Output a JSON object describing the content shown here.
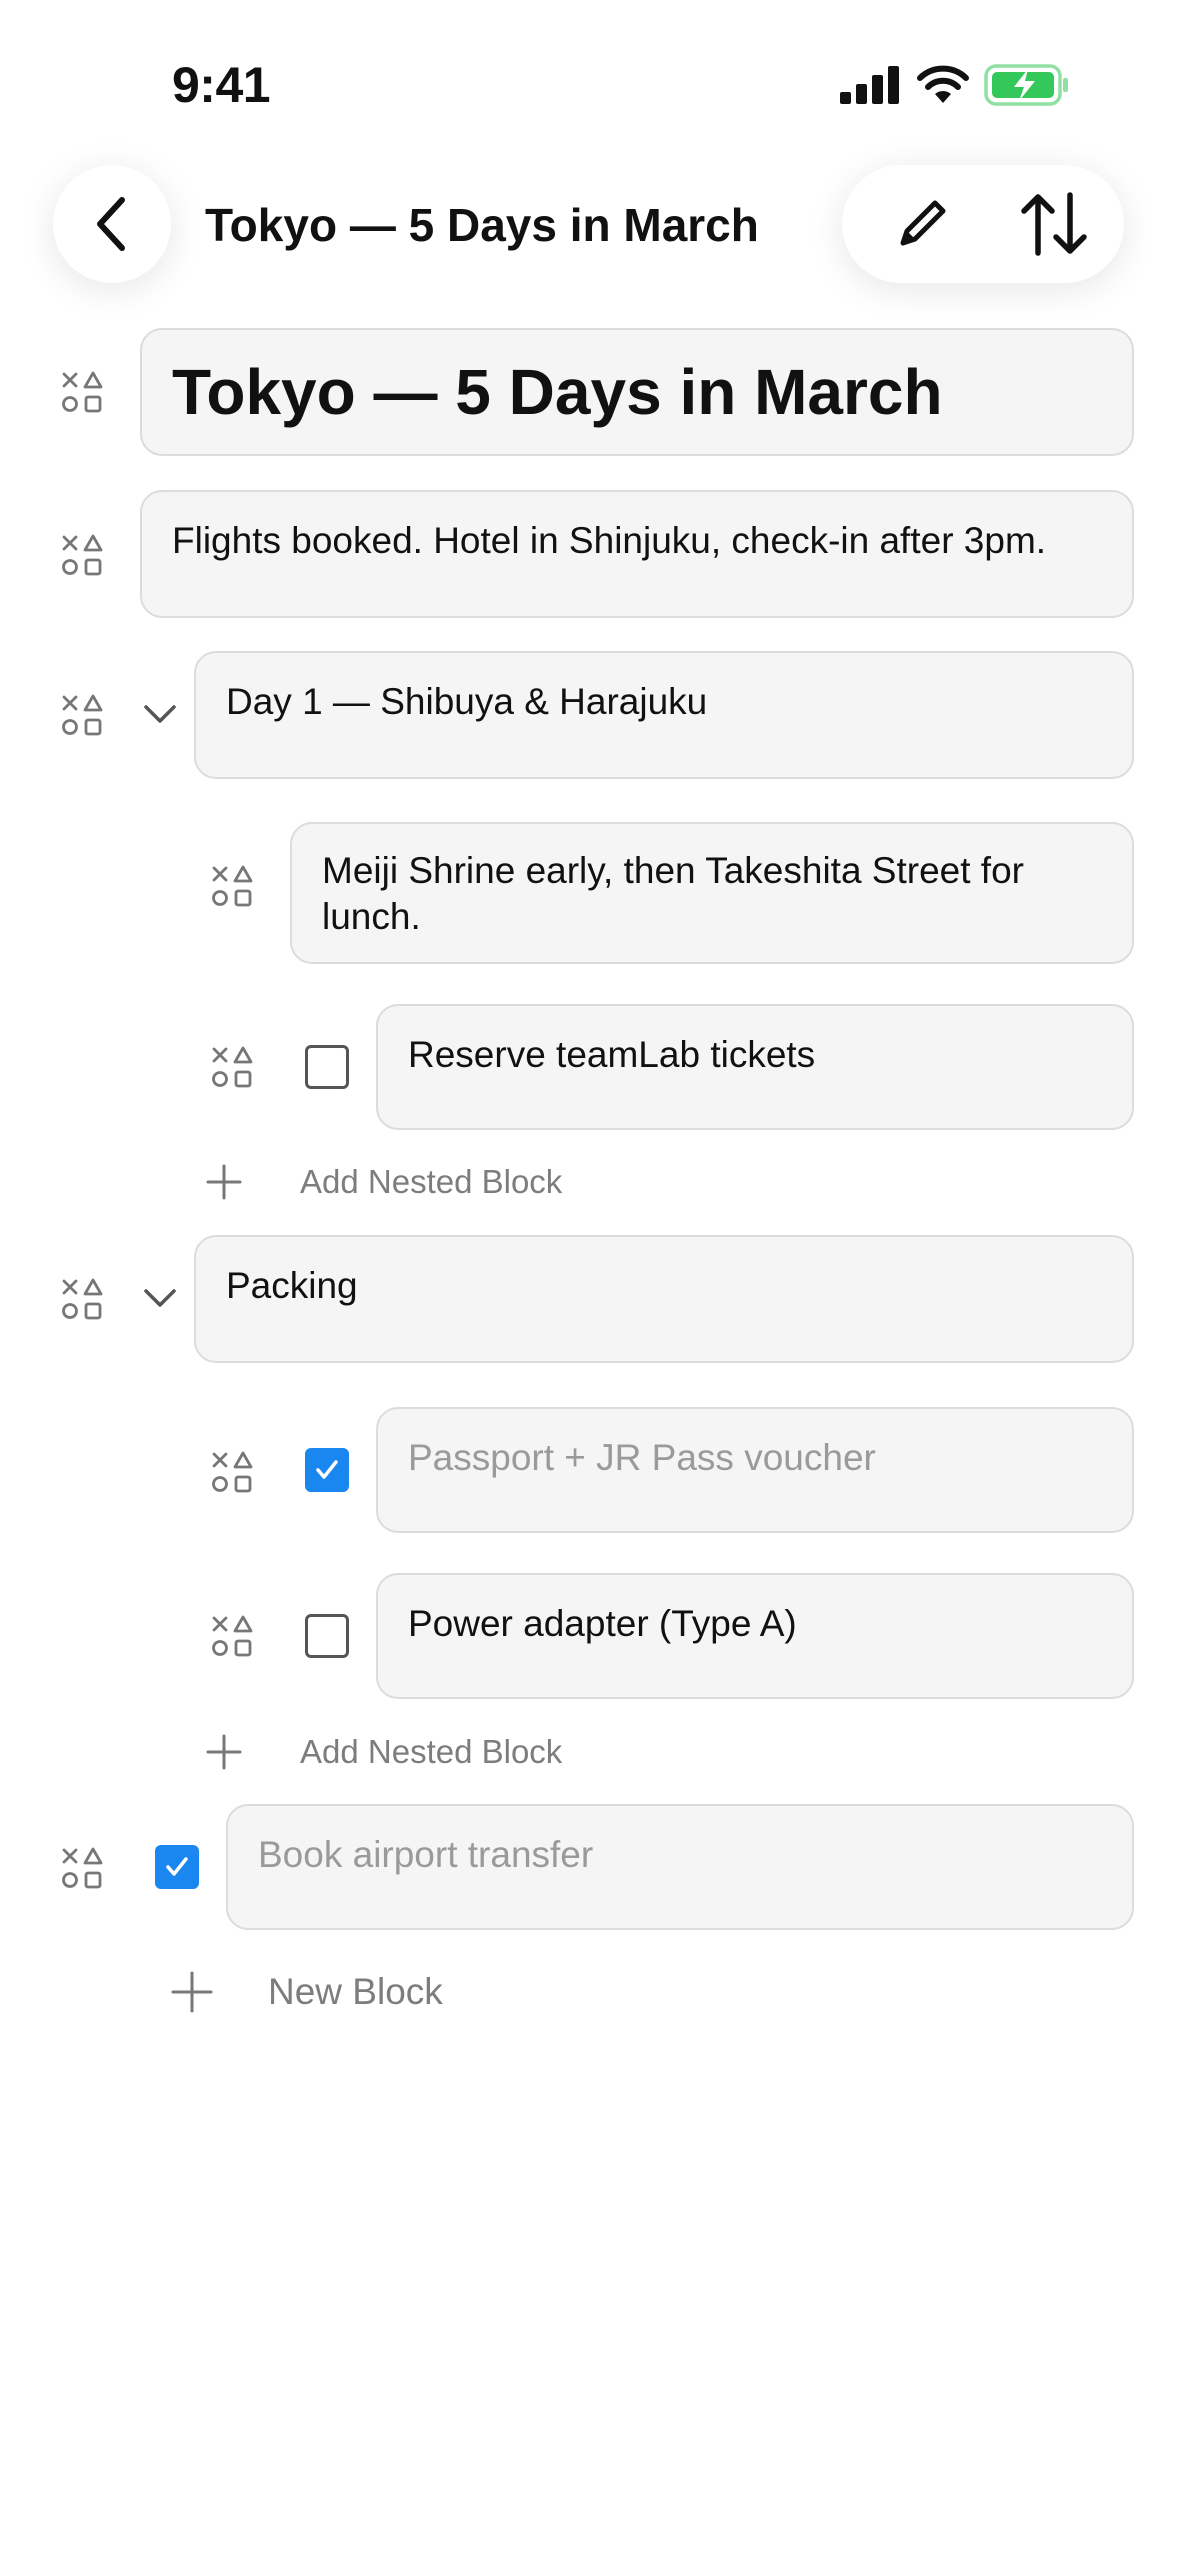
{
  "status_bar": {
    "time": "9:41"
  },
  "nav": {
    "title": "Tokyo — 5 Days in March"
  },
  "blocks": {
    "heading": "Tokyo — 5 Days in March",
    "note": "Flights booked. Hotel in Shinjuku, check-in after 3pm.",
    "day1": {
      "title": "Day 1 — Shibuya & Harajuku",
      "note": "Meiji Shrine early, then Takeshita Street for lunch.",
      "todo": {
        "label": "Reserve teamLab tickets",
        "checked": false
      },
      "add_label": "Add Nested Block"
    },
    "packing": {
      "title": "Packing",
      "todo1": {
        "label": "Passport + JR Pass voucher",
        "checked": true
      },
      "todo2": {
        "label": "Power adapter (Type A)",
        "checked": false
      },
      "add_label": "Add Nested Block"
    },
    "todo_transfer": {
      "label": "Book airport transfer",
      "checked": true
    }
  },
  "new_block_label": "New Block",
  "colors": {
    "accent": "#1a86f0",
    "battery": "#34c759",
    "block_bg": "#f5f5f5",
    "block_border": "#dcdcdc"
  }
}
